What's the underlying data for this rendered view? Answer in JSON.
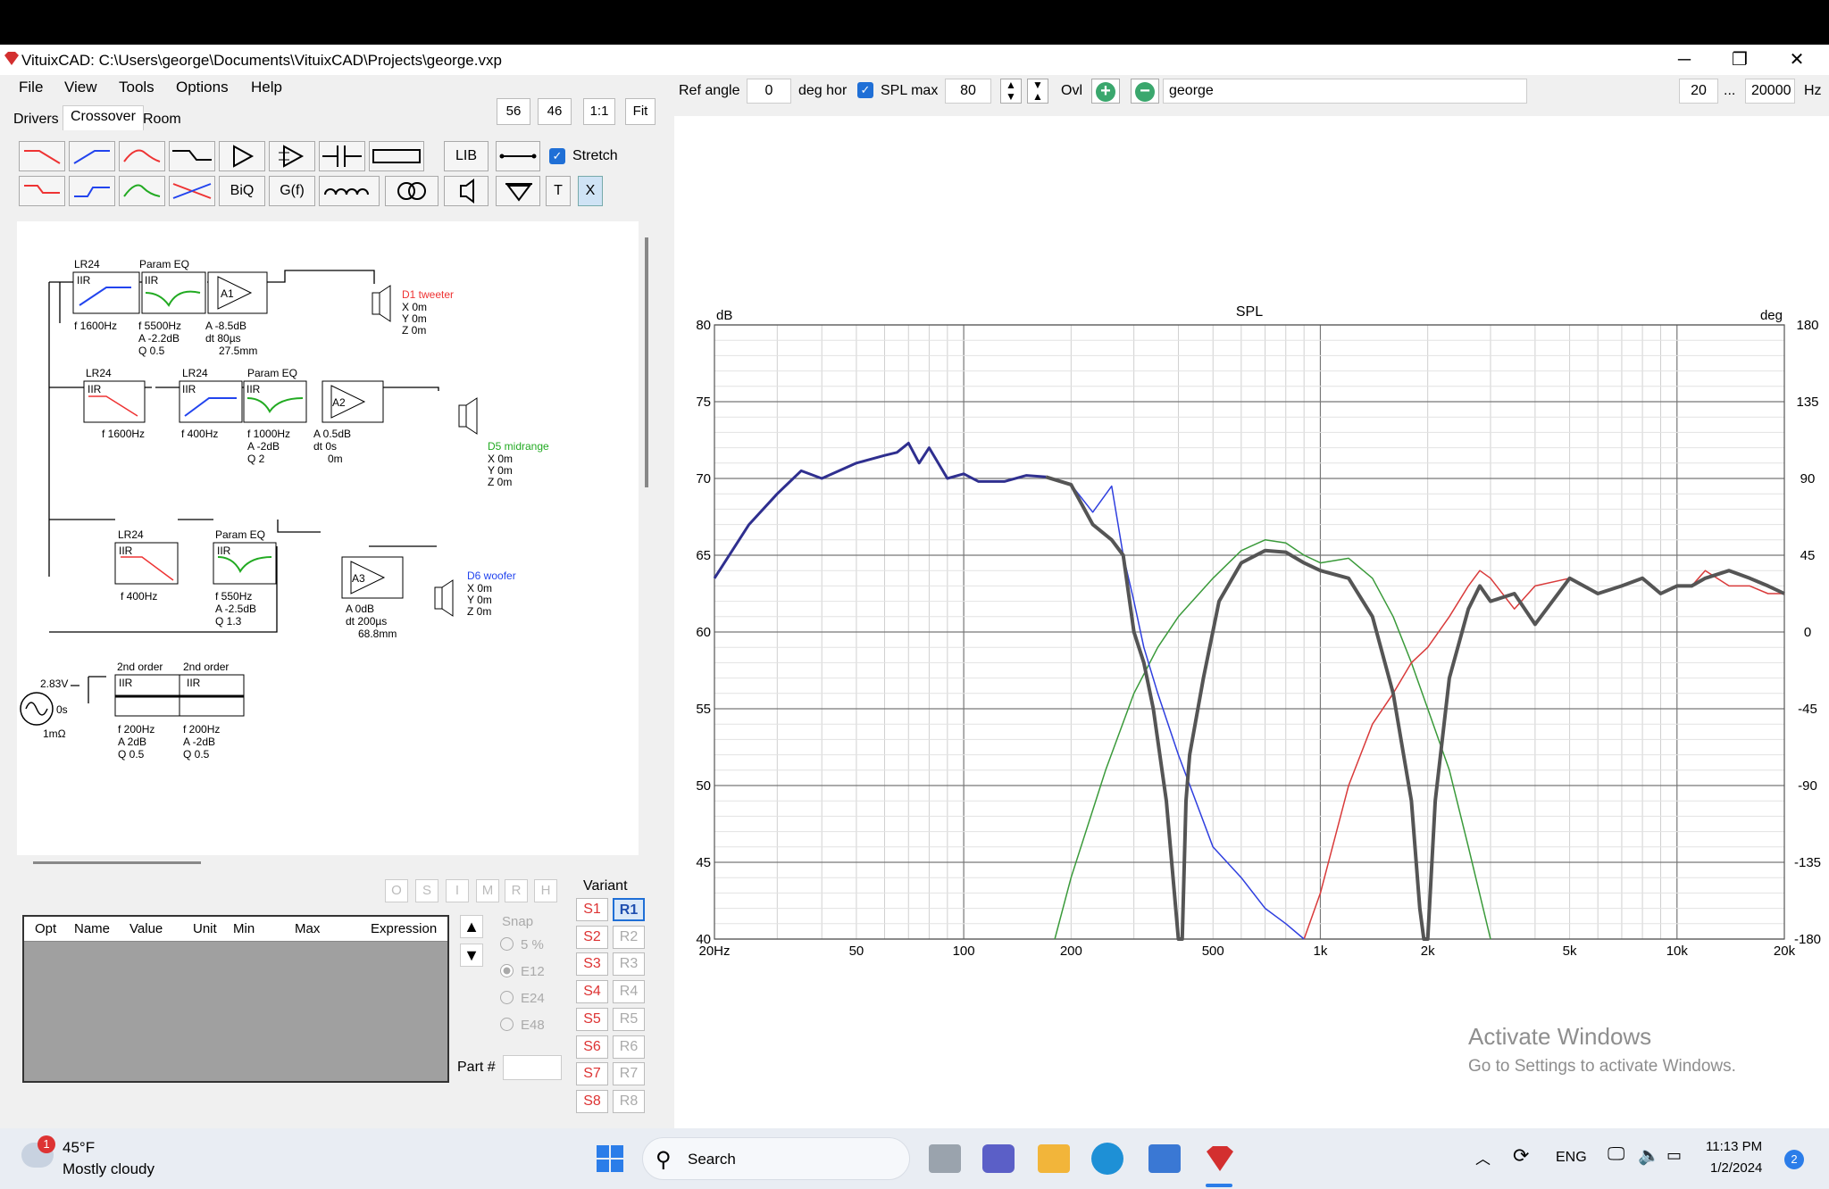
{
  "window": {
    "title": "VituixCAD: C:\\Users\\george\\Documents\\VituixCAD\\Projects\\george.vxp",
    "min": "─",
    "max": "❐",
    "close": "✕"
  },
  "menu": [
    "File",
    "View",
    "Tools",
    "Options",
    "Help"
  ],
  "tabs": [
    "Drivers",
    "Crossover",
    "Room"
  ],
  "scale_btns": [
    "56",
    "46",
    "1:1",
    "Fit"
  ],
  "toolbar": {
    "lib": "LIB",
    "biq": "BiQ",
    "gf": "G(f)",
    "t": "T",
    "x": "X",
    "stretch": "Stretch"
  },
  "schematic": {
    "tweeter": {
      "lr": "LR24",
      "peq": "Param EQ",
      "iir": "IIR",
      "f1": "f   1600Hz",
      "f2": "f   5500Hz",
      "a2": "A  -2.2dB",
      "q2": "Q 0.5",
      "a3": "A  -8.5dB",
      "dt3": "dt 80µs",
      "mm3": "27.5mm",
      "amp": "A1",
      "name": "D1 tweeter",
      "x": "X 0m",
      "y": "Y 0m",
      "z": "Z 0m"
    },
    "mid": {
      "lr1": "LR24",
      "lr2": "LR24",
      "peq": "Param EQ",
      "f1": "f   1600Hz",
      "f2": "f   400Hz",
      "f3": "f   1000Hz",
      "a3": "A  -2dB",
      "q3": "Q  2",
      "a4": "A  0.5dB",
      "dt4": "dt 0s",
      "mm4": "0m",
      "amp": "A2",
      "name": "D5 midrange",
      "x": "X 0m",
      "y": "Y 0m",
      "z": "Z 0m"
    },
    "woofer": {
      "lr": "LR24",
      "peq": "Param EQ",
      "f1": "f   400Hz",
      "f2": "f   550Hz",
      "a2": "A  -2.5dB",
      "q2": "Q 1.3",
      "a3": "A  0dB",
      "dt3": "dt 200µs",
      "mm3": "68.8mm",
      "amp": "A3",
      "name": "D6 woofer",
      "x": "X 0m",
      "y": "Y 0m",
      "z": "Z 0m"
    },
    "source": {
      "v": "2.83V",
      "t": "0s",
      "r": "1mΩ"
    },
    "shelf": {
      "o1": "2nd order",
      "o2": "2nd order",
      "f1": "f   200Hz",
      "a1": "A  2dB",
      "q1": "Q 0.5",
      "f2": "f   200Hz",
      "a2": "A  -2dB",
      "q2": "Q 0.5"
    }
  },
  "table": {
    "headers": [
      "Opt",
      "Name",
      "Value",
      "Unit",
      "Min",
      "Max",
      "Expression"
    ]
  },
  "letters": [
    "O",
    "S",
    "I",
    "M",
    "R",
    "H"
  ],
  "snap": {
    "label": "Snap",
    "opts": [
      "5 %",
      "E12",
      "E24",
      "E48"
    ],
    "part": "Part #"
  },
  "variant": {
    "label": "Variant",
    "s": [
      "S1",
      "S2",
      "S3",
      "S4",
      "S5",
      "S6",
      "S7",
      "S8"
    ],
    "r": [
      "R1",
      "R2",
      "R3",
      "R4",
      "R5",
      "R6",
      "R7",
      "R8"
    ]
  },
  "controls": {
    "ref_angle": "Ref angle",
    "ref_val": "0",
    "deg_hor": "deg hor",
    "spl_max": "SPL max",
    "spl_val": "80",
    "ovl": "Ovl",
    "name": "george",
    "fmin": "20",
    "dots": "...",
    "fmax": "20000",
    "hz": "Hz"
  },
  "chart_data": {
    "type": "line",
    "title": "SPL",
    "ylabel_left": "dB",
    "ylabel_right": "deg",
    "xscale": "log",
    "xlim": [
      20,
      20000
    ],
    "ylim": [
      40,
      80
    ],
    "ylim_right": [
      -180,
      180
    ],
    "xticks": [
      "20Hz",
      "50",
      "100",
      "200",
      "500",
      "1k",
      "2k",
      "5k",
      "10k",
      "20k"
    ],
    "xtick_vals": [
      20,
      50,
      100,
      200,
      500,
      1000,
      2000,
      5000,
      10000,
      20000
    ],
    "yticks": [
      80,
      75,
      70,
      65,
      60,
      55,
      50,
      45,
      40
    ],
    "yticks_right": [
      180,
      135,
      90,
      45,
      0,
      -45,
      -90,
      -135,
      -180
    ],
    "series": [
      {
        "color": "#2f2f8f",
        "width": 3,
        "x": [
          20,
          25,
          30,
          35,
          40,
          50,
          60,
          65,
          70,
          75,
          80,
          90,
          100,
          110,
          130,
          150,
          170
        ],
        "y": [
          63.5,
          67,
          69,
          70.5,
          70,
          71,
          71.5,
          71.7,
          72.3,
          71,
          72,
          70,
          70.3,
          69.8,
          69.8,
          70.2,
          70.1
        ]
      },
      {
        "color": "#555555",
        "width": 4,
        "x": [
          170,
          200,
          230,
          260,
          280,
          300,
          320,
          340,
          370,
          400,
          410,
          420,
          430,
          470,
          520,
          600,
          700,
          800,
          900,
          1000,
          1200,
          1400,
          1600,
          1800,
          1900,
          1950,
          2000,
          2100,
          2300,
          2600,
          2800,
          3000,
          3500,
          4000,
          5000,
          6000,
          7000,
          8000,
          9000,
          10000,
          11000,
          12000,
          14000,
          16000,
          18000,
          20000
        ],
        "y": [
          70.1,
          69.6,
          67,
          66,
          65,
          60,
          58,
          55,
          49,
          40,
          40,
          49,
          52,
          57,
          62,
          64.5,
          65.3,
          65.2,
          64.5,
          64,
          63.5,
          61,
          56,
          49,
          42,
          40,
          40,
          49,
          57,
          61.5,
          63,
          62,
          62.5,
          60.5,
          63.5,
          62.5,
          63,
          63.5,
          62.5,
          63,
          63,
          63.5,
          64,
          63.5,
          63,
          62.5
        ]
      },
      {
        "color": "#2f3fdf",
        "width": 1.5,
        "x": [
          170,
          200,
          230,
          260,
          280,
          300,
          320,
          350,
          400,
          500,
          600,
          700,
          800,
          900
        ],
        "y": [
          70.1,
          69.6,
          67.8,
          69.5,
          65,
          62,
          59,
          56,
          52,
          46,
          44,
          42,
          41,
          40
        ]
      },
      {
        "color": "#3a9a3a",
        "width": 1.5,
        "x": [
          180,
          200,
          250,
          300,
          350,
          400,
          500,
          600,
          700,
          800,
          900,
          1000,
          1200,
          1400,
          1600,
          1800,
          2000,
          2300,
          2600,
          3000
        ],
        "y": [
          40,
          44,
          51,
          56,
          59,
          61,
          63.5,
          65.3,
          66,
          65.8,
          65,
          64.5,
          64.8,
          63.5,
          61,
          58,
          55,
          51,
          46,
          40
        ]
      },
      {
        "color": "#d93a3a",
        "width": 1.5,
        "x": [
          900,
          1000,
          1200,
          1400,
          1600,
          1800,
          2000,
          2300,
          2600,
          2800,
          3000,
          3500,
          4000,
          5000,
          6000,
          7000,
          8000,
          9000,
          10000,
          11000,
          12000,
          14000,
          16000,
          18000,
          20000
        ],
        "y": [
          40,
          43,
          50,
          54,
          56,
          58,
          59,
          61,
          63,
          64,
          63.5,
          61.5,
          63,
          63.5,
          62.5,
          63,
          63.5,
          62.5,
          63,
          63,
          64,
          63,
          63,
          62.5,
          62.5
        ]
      }
    ]
  },
  "watermark": {
    "title": "Activate Windows",
    "sub": "Go to Settings to activate Windows."
  },
  "taskbar": {
    "temp": "45°F",
    "weather": "Mostly cloudy",
    "badge": "1",
    "search": "Search",
    "lang": "ENG",
    "time": "11:13 PM",
    "date": "1/2/2024",
    "notif": "2"
  }
}
